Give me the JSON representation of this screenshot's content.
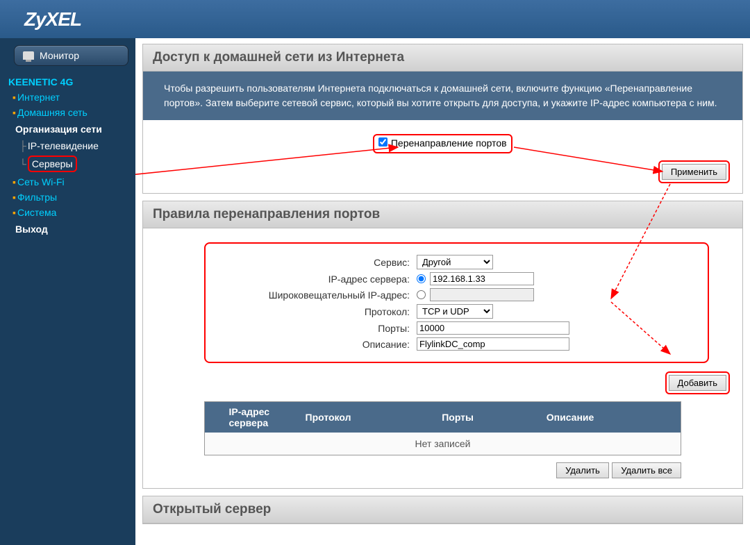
{
  "brand": "ZyXEL",
  "sidebar": {
    "monitor": "Монитор",
    "device": "KEENETIC 4G",
    "items": [
      {
        "label": "Интернет",
        "color": "cyan"
      },
      {
        "label": "Домашняя сеть",
        "color": "cyan"
      },
      {
        "label": "Организация сети",
        "color": "white"
      },
      {
        "label": "IP-телевидение",
        "color": "white-sub"
      },
      {
        "label": "Серверы",
        "color": "white-sub",
        "highlighted": true
      },
      {
        "label": "Сеть Wi-Fi",
        "color": "cyan"
      },
      {
        "label": "Фильтры",
        "color": "cyan"
      },
      {
        "label": "Система",
        "color": "cyan"
      },
      {
        "label": "Выход",
        "color": "white-plain"
      }
    ]
  },
  "main": {
    "panel1_title": "Доступ к домашней сети из Интернета",
    "panel1_desc": "Чтобы разрешить пользователям Интернета подключаться к домашней сети, включите функцию «Перенаправление портов». Затем выберите сетевой сервис, который вы хотите открыть для доступа, и укажите IP-адрес компьютера с ним.",
    "port_fwd_checkbox": "Перенаправление портов",
    "apply_btn": "Применить",
    "panel2_title": "Правила перенаправления портов",
    "form": {
      "service_label": "Сервис:",
      "service_value": "Другой",
      "ip_label": "IP-адрес сервера:",
      "ip_value": "192.168.1.33",
      "broadcast_label": "Широковещательный IP-адрес:",
      "broadcast_value": "",
      "protocol_label": "Протокол:",
      "protocol_value": "TCP и UDP",
      "ports_label": "Порты:",
      "ports_value": "10000",
      "desc_label": "Описание:",
      "desc_value": "FlylinkDC_comp"
    },
    "add_btn": "Добавить",
    "table": {
      "headers": [
        "IP-адрес сервера",
        "Протокол",
        "Порты",
        "Описание"
      ],
      "empty": "Нет записей"
    },
    "delete_btn": "Удалить",
    "delete_all_btn": "Удалить все",
    "panel3_title": "Открытый сервер"
  }
}
